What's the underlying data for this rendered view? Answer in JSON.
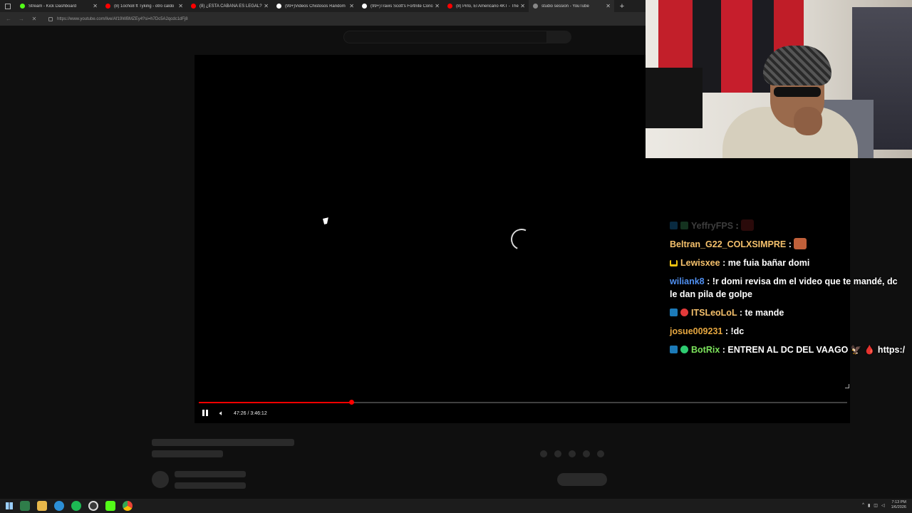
{
  "browser": {
    "tabs": [
      {
        "title": "Stream - Kick Dashboard",
        "favicon_color": "#53fc18",
        "active": false
      },
      {
        "title": "(8) 1ocho8 ft Tyking - otro caldo",
        "favicon_color": "#ff0000",
        "active": false
      },
      {
        "title": "(8) ¿ESTA CABAÑA ES LEGAL? 😳",
        "favicon_color": "#ff0000",
        "active": false
      },
      {
        "title": "(99+)Videos Chistosos Random",
        "favicon_color": "#ffffff",
        "active": false
      },
      {
        "title": "(99+)Travis Scott's Fortnite Conce",
        "favicon_color": "#ffffff",
        "active": false
      },
      {
        "title": "(8) Pirlo, El Americano 4KT - The",
        "favicon_color": "#ff0000",
        "active": false
      },
      {
        "title": "studio session - YouTube",
        "favicon_color": "#888888",
        "active": true
      }
    ],
    "new_tab": "+",
    "url": "https://www.youtube.com/live/Af19WBMZEy4?si=h7Dc5A2qcdc1dFj8"
  },
  "player": {
    "time_display": "47:26 / 3:46:12",
    "progress_fraction": 0.235,
    "state": "loading",
    "accent": "#ff0000"
  },
  "chat": [
    {
      "user": "YeffryFPS",
      "text": "",
      "user_color": "#b0b0b0",
      "badges": [
        "mod",
        "vip"
      ],
      "emote": "#7a1f1f",
      "faded": true
    },
    {
      "user": "Beltran_G22_COLXSIMPRE",
      "text": "",
      "user_color": "#f5c16c",
      "badges": [],
      "emote": "#c0603a",
      "faded": false
    },
    {
      "user": "Lewisxee",
      "text": "me fuia bañar domi",
      "user_color": "#f5c16c",
      "badges": [
        "crown"
      ],
      "emote": "",
      "faded": false
    },
    {
      "user": "wiliank8",
      "text": "!r domi revisa dm el video que te mandé, dc",
      "text2": "le dan pila de golpe",
      "user_color": "#4f8ff0",
      "badges": [],
      "emote": "",
      "faded": false
    },
    {
      "user": "ITSLeoLoL",
      "text": "te mande",
      "user_color": "#f5c16c",
      "badges": [
        "mod",
        "red"
      ],
      "emote": "",
      "faded": false
    },
    {
      "user": "josue009231",
      "text": "!dc",
      "user_color": "#e6a740",
      "badges": [],
      "emote": "",
      "faded": false
    },
    {
      "user": "BotRix",
      "text": "ENTREN AL DC DEL VAAGO 🦅 🩸 https:/",
      "user_color": "#7ce35c",
      "badges": [
        "mod",
        "green"
      ],
      "emote": "",
      "faded": false
    }
  ],
  "taskbar": {
    "time": "7:13 PM",
    "date": "1/6/2026",
    "apps": [
      "windows-icon",
      "terminal-icon",
      "folder-icon",
      "edge-icon",
      "spotify-icon",
      "obs-icon",
      "kick-icon",
      "chrome-icon"
    ]
  }
}
